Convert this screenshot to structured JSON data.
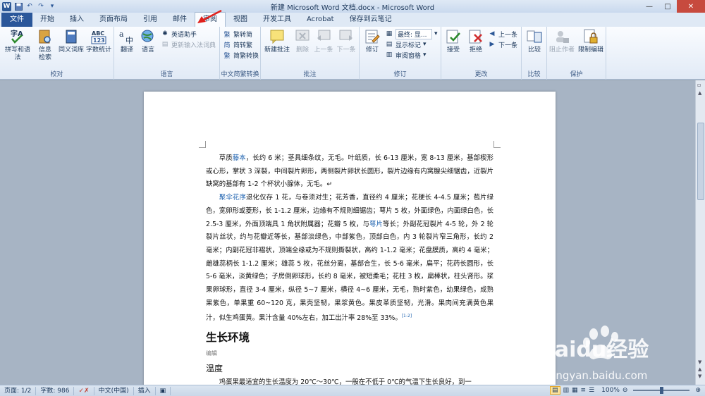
{
  "window": {
    "title": "新建 Microsoft Word 文档.docx - Microsoft Word",
    "app_icon": "W"
  },
  "tabs": [
    "文件",
    "开始",
    "插入",
    "页面布局",
    "引用",
    "邮件",
    "审阅",
    "视图",
    "开发工具",
    "Acrobat",
    "保存到云笔记"
  ],
  "active_tab": "审阅",
  "ribbon": {
    "proofing": {
      "label": "校对",
      "spelling": "拼写和语法",
      "research": "信息检索",
      "thesaurus": "同义词库",
      "wordcount": "字数统计"
    },
    "language": {
      "label": "语言",
      "translate": "翻译",
      "language": "语言",
      "eng_assist": "英语助手",
      "update_ime": "更新输入法词典"
    },
    "chinese": {
      "label": "中文简繁转换",
      "to_simp": "繁转简",
      "to_trad": "简转繁",
      "convert": "简繁转换"
    },
    "comments": {
      "label": "批注",
      "new": "新建批注",
      "delete": "删除",
      "prev": "上一条",
      "next": "下一条"
    },
    "tracking": {
      "label": "修订",
      "track": "修订",
      "display": "最终: 显...",
      "show_markup": "显示标记",
      "pane": "审阅窗格"
    },
    "changes": {
      "label": "更改",
      "accept": "接受",
      "reject": "拒绝",
      "prev": "上一条",
      "next": "下一条"
    },
    "compare": {
      "label": "比较",
      "compare": "比较"
    },
    "protect": {
      "label": "保护",
      "block": "阻止作者",
      "restrict": "限制编辑"
    }
  },
  "document": {
    "p1_pre": "草质",
    "p1_link": "藤本",
    "p1_post": "，长约 6 米；茎具细条纹，无毛。叶纸质，长 6-13 厘米，宽 8-13 厘米，基部楔形或心形，掌状 3 深裂，中间裂片卵形，两侧裂片卵状长圆形，裂片边缘有内窝腺尖细锯齿，近裂片缺窝的基部有 1-2 个杯状小腺体，无毛。↵",
    "p2_link": "聚伞花序",
    "p2_mid1": "退化仅存 1 花，与卷须对生；花芳香，直径约 4 厘米；花梗长 4-4.5 厘米；苞片绿色，宽卵形或菱形，长 1-1.2 厘米，边缘有不规则细锯齿；萼片 5 枚，外面绿色，内面绿白色，长 2.5-3 厘米，外面顶端具 1 角状附属器；花瓣 5 枚，与",
    "p2_link2": "萼片",
    "p2_post": "等长；外副花冠裂片 4-5 轮，外 2 轮裂片丝状，约与花瓣近等长，基部淡绿色，中部紫色，顶部白色，内 3 轮裂片窄三角形，长约 2 毫米；内副花冠非褶状，顶端全缘或为不规则撕裂状，高约 1-1.2 毫米；花盘膜质，高约 4 毫米；雌雄蕊柄长 1-1.2 厘米；雄蕊 5 枚，花丝分离，基部合生，长 5-6 毫米，扁平；花药长圆形，长 5-6 毫米，淡黄绿色；子房倒卵球形，长约 8 毫米，被短柔毛；花柱 3 枚，扁棒状，柱头肾形。浆果卵球形，直径 3-4 厘米，纵径 5~7 厘米，横径 4~6 厘米，无毛，熟时紫色，幼果绿色，成熟果紫色，单果重 60~120 克，果壳坚韧，果浆黄色。果皮革质坚韧，光滑。果肉间充满黄色果汁，似生鸡蛋黄。果汁含量 40%左右，加工出汁率 28%至 33%。",
    "p2_ref": "[1-2]",
    "h1": "生长环境",
    "edit": "编辑",
    "h2": "温度",
    "p3": "鸡蛋果最适宜的生长温度为 20℃～30℃，一般在不低于 0℃的气温下生长良好，到一"
  },
  "status": {
    "page": "页面: 1/2",
    "words": "字数: 986",
    "lang": "中文(中国)",
    "insert": "插入",
    "zoom": "100%"
  },
  "watermark": {
    "brand": "Baidu经验",
    "url": "jingyan.baidu.com"
  }
}
